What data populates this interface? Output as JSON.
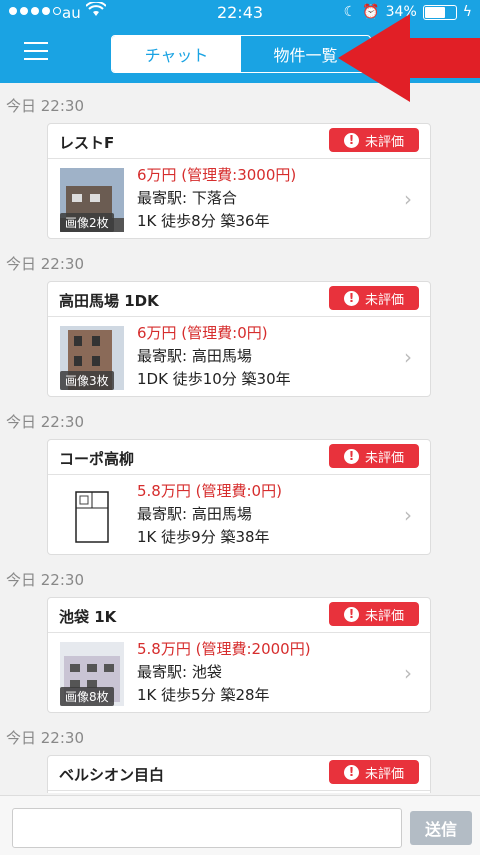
{
  "status_bar": {
    "carrier": "au",
    "time": "22:43",
    "battery_text": "34%"
  },
  "header": {
    "tabs": [
      {
        "label": "チャット",
        "active": true
      },
      {
        "label": "物件一覧",
        "active": false
      }
    ]
  },
  "colors": {
    "header_bg": "#1aa3e3",
    "price": "#d62d2d",
    "badge": "#e8323c",
    "arrow": "#e11f26"
  },
  "messages": [
    {
      "timestamp": "今日 22:30",
      "title": "レストF",
      "badge": "未評価",
      "price": "6万円 (管理費:3000円)",
      "station": "最寄駅:  下落合",
      "details": "1K   徒歩8分   築36年",
      "image_tag": "画像2枚"
    },
    {
      "timestamp": "今日 22:30",
      "title": "高田馬場 1DK",
      "badge": "未評価",
      "price": "6万円 (管理費:0円)",
      "station": "最寄駅:  高田馬場",
      "details": "1DK   徒歩10分   築30年",
      "image_tag": "画像3枚"
    },
    {
      "timestamp": "今日 22:30",
      "title": "コーポ高柳",
      "badge": "未評価",
      "price": "5.8万円 (管理費:0円)",
      "station": "最寄駅:  高田馬場",
      "details": "1K   徒歩9分   築38年",
      "image_tag": ""
    },
    {
      "timestamp": "今日 22:30",
      "title": "池袋 1K",
      "badge": "未評価",
      "price": "5.8万円 (管理費:2000円)",
      "station": "最寄駅:  池袋",
      "details": "1K   徒歩5分   築28年",
      "image_tag": "画像8枚"
    },
    {
      "timestamp": "今日 22:30",
      "title": "ベルシオン目白",
      "badge": "未評価",
      "price": "",
      "station": "",
      "details": "",
      "image_tag": ""
    }
  ],
  "composer": {
    "send_label": "送信"
  }
}
